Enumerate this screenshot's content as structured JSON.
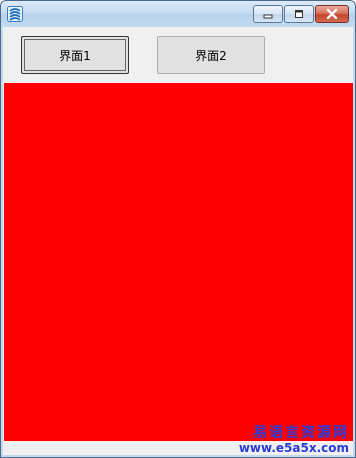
{
  "window": {
    "title": "",
    "minimize_icon": "minimize-icon",
    "maximize_icon": "maximize-icon",
    "close_icon": "close-icon"
  },
  "toolbar": {
    "button1_label": "界面1",
    "button2_label": "界面2"
  },
  "panel": {
    "color": "#ff0000"
  },
  "watermark": {
    "line1": "易语言资源网",
    "line2": "www.e5a5x.com"
  }
}
